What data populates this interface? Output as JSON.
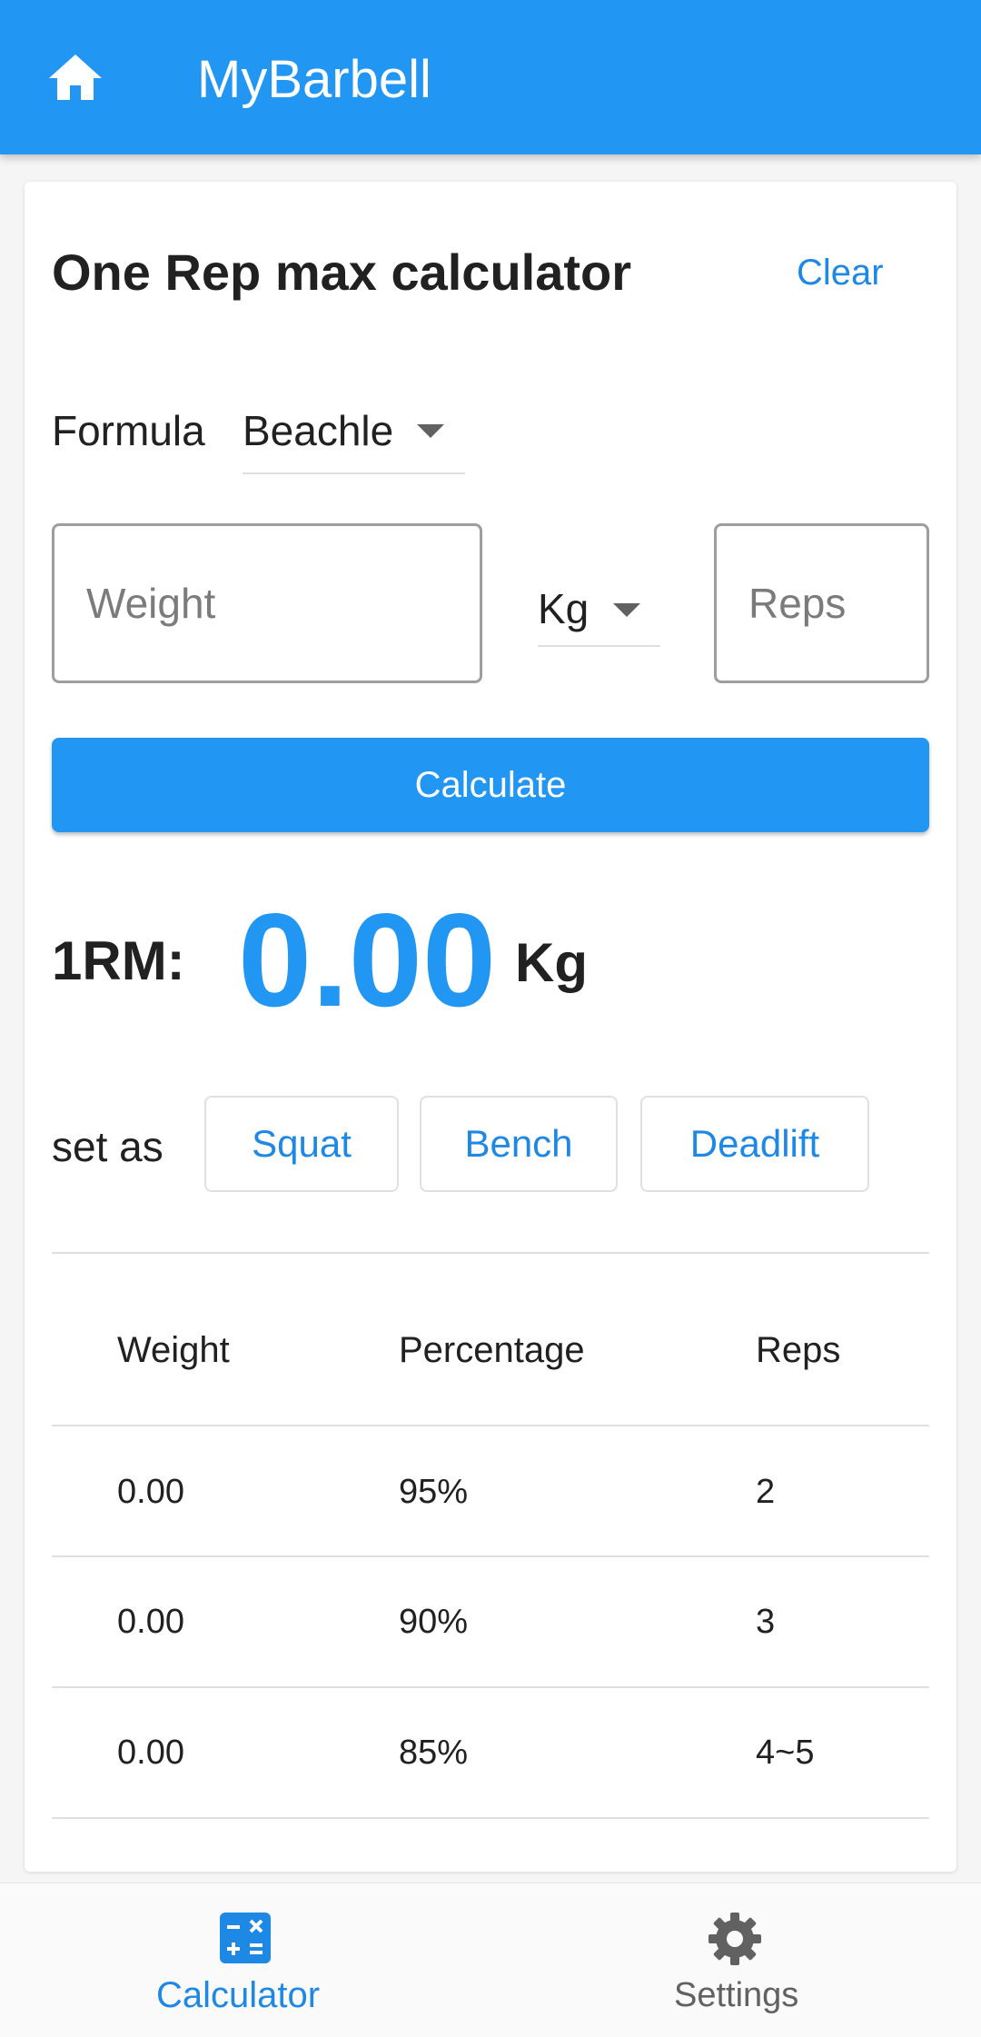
{
  "app": {
    "title": "MyBarbell"
  },
  "calculator": {
    "title": "One Rep max calculator",
    "clear_label": "Clear",
    "formula_label": "Formula",
    "formula_value": "Beachle",
    "weight_placeholder": "Weight",
    "unit_value": "Kg",
    "reps_placeholder": "Reps",
    "calculate_label": "Calculate",
    "result_label": "1RM:",
    "result_value": "0.00",
    "result_unit": "Kg",
    "set_as_label": "set as",
    "set_as_buttons": [
      "Squat",
      "Bench",
      "Deadlift"
    ]
  },
  "table": {
    "headers": [
      "Weight",
      "Percentage",
      "Reps"
    ],
    "rows": [
      [
        "0.00",
        "95%",
        "2"
      ],
      [
        "0.00",
        "90%",
        "3"
      ],
      [
        "0.00",
        "85%",
        "4~5"
      ]
    ]
  },
  "bottom_nav": {
    "items": [
      {
        "label": "Calculator",
        "icon": "calculator-icon",
        "active": true
      },
      {
        "label": "Settings",
        "icon": "gear-icon",
        "active": false
      }
    ]
  },
  "colors": {
    "primary": "#2196f3",
    "accent_text": "#1e88e5"
  }
}
